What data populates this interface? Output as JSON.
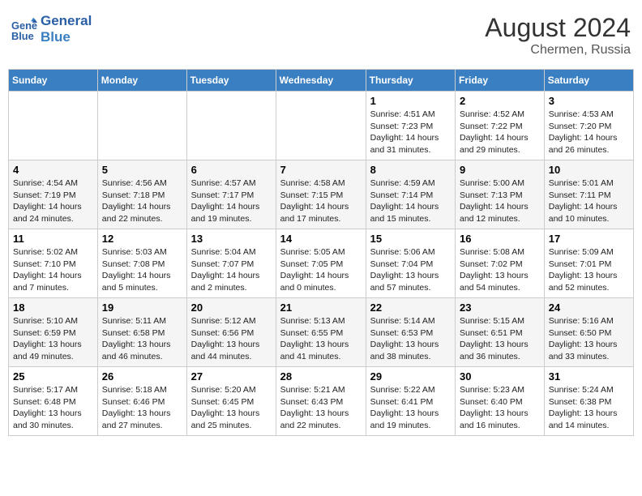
{
  "header": {
    "logo_line1": "General",
    "logo_line2": "Blue",
    "month_year": "August 2024",
    "location": "Chermen, Russia"
  },
  "days_of_week": [
    "Sunday",
    "Monday",
    "Tuesday",
    "Wednesday",
    "Thursday",
    "Friday",
    "Saturday"
  ],
  "weeks": [
    [
      {
        "day": "",
        "detail": ""
      },
      {
        "day": "",
        "detail": ""
      },
      {
        "day": "",
        "detail": ""
      },
      {
        "day": "",
        "detail": ""
      },
      {
        "day": "1",
        "detail": "Sunrise: 4:51 AM\nSunset: 7:23 PM\nDaylight: 14 hours\nand 31 minutes."
      },
      {
        "day": "2",
        "detail": "Sunrise: 4:52 AM\nSunset: 7:22 PM\nDaylight: 14 hours\nand 29 minutes."
      },
      {
        "day": "3",
        "detail": "Sunrise: 4:53 AM\nSunset: 7:20 PM\nDaylight: 14 hours\nand 26 minutes."
      }
    ],
    [
      {
        "day": "4",
        "detail": "Sunrise: 4:54 AM\nSunset: 7:19 PM\nDaylight: 14 hours\nand 24 minutes."
      },
      {
        "day": "5",
        "detail": "Sunrise: 4:56 AM\nSunset: 7:18 PM\nDaylight: 14 hours\nand 22 minutes."
      },
      {
        "day": "6",
        "detail": "Sunrise: 4:57 AM\nSunset: 7:17 PM\nDaylight: 14 hours\nand 19 minutes."
      },
      {
        "day": "7",
        "detail": "Sunrise: 4:58 AM\nSunset: 7:15 PM\nDaylight: 14 hours\nand 17 minutes."
      },
      {
        "day": "8",
        "detail": "Sunrise: 4:59 AM\nSunset: 7:14 PM\nDaylight: 14 hours\nand 15 minutes."
      },
      {
        "day": "9",
        "detail": "Sunrise: 5:00 AM\nSunset: 7:13 PM\nDaylight: 14 hours\nand 12 minutes."
      },
      {
        "day": "10",
        "detail": "Sunrise: 5:01 AM\nSunset: 7:11 PM\nDaylight: 14 hours\nand 10 minutes."
      }
    ],
    [
      {
        "day": "11",
        "detail": "Sunrise: 5:02 AM\nSunset: 7:10 PM\nDaylight: 14 hours\nand 7 minutes."
      },
      {
        "day": "12",
        "detail": "Sunrise: 5:03 AM\nSunset: 7:08 PM\nDaylight: 14 hours\nand 5 minutes."
      },
      {
        "day": "13",
        "detail": "Sunrise: 5:04 AM\nSunset: 7:07 PM\nDaylight: 14 hours\nand 2 minutes."
      },
      {
        "day": "14",
        "detail": "Sunrise: 5:05 AM\nSunset: 7:05 PM\nDaylight: 14 hours\nand 0 minutes."
      },
      {
        "day": "15",
        "detail": "Sunrise: 5:06 AM\nSunset: 7:04 PM\nDaylight: 13 hours\nand 57 minutes."
      },
      {
        "day": "16",
        "detail": "Sunrise: 5:08 AM\nSunset: 7:02 PM\nDaylight: 13 hours\nand 54 minutes."
      },
      {
        "day": "17",
        "detail": "Sunrise: 5:09 AM\nSunset: 7:01 PM\nDaylight: 13 hours\nand 52 minutes."
      }
    ],
    [
      {
        "day": "18",
        "detail": "Sunrise: 5:10 AM\nSunset: 6:59 PM\nDaylight: 13 hours\nand 49 minutes."
      },
      {
        "day": "19",
        "detail": "Sunrise: 5:11 AM\nSunset: 6:58 PM\nDaylight: 13 hours\nand 46 minutes."
      },
      {
        "day": "20",
        "detail": "Sunrise: 5:12 AM\nSunset: 6:56 PM\nDaylight: 13 hours\nand 44 minutes."
      },
      {
        "day": "21",
        "detail": "Sunrise: 5:13 AM\nSunset: 6:55 PM\nDaylight: 13 hours\nand 41 minutes."
      },
      {
        "day": "22",
        "detail": "Sunrise: 5:14 AM\nSunset: 6:53 PM\nDaylight: 13 hours\nand 38 minutes."
      },
      {
        "day": "23",
        "detail": "Sunrise: 5:15 AM\nSunset: 6:51 PM\nDaylight: 13 hours\nand 36 minutes."
      },
      {
        "day": "24",
        "detail": "Sunrise: 5:16 AM\nSunset: 6:50 PM\nDaylight: 13 hours\nand 33 minutes."
      }
    ],
    [
      {
        "day": "25",
        "detail": "Sunrise: 5:17 AM\nSunset: 6:48 PM\nDaylight: 13 hours\nand 30 minutes."
      },
      {
        "day": "26",
        "detail": "Sunrise: 5:18 AM\nSunset: 6:46 PM\nDaylight: 13 hours\nand 27 minutes."
      },
      {
        "day": "27",
        "detail": "Sunrise: 5:20 AM\nSunset: 6:45 PM\nDaylight: 13 hours\nand 25 minutes."
      },
      {
        "day": "28",
        "detail": "Sunrise: 5:21 AM\nSunset: 6:43 PM\nDaylight: 13 hours\nand 22 minutes."
      },
      {
        "day": "29",
        "detail": "Sunrise: 5:22 AM\nSunset: 6:41 PM\nDaylight: 13 hours\nand 19 minutes."
      },
      {
        "day": "30",
        "detail": "Sunrise: 5:23 AM\nSunset: 6:40 PM\nDaylight: 13 hours\nand 16 minutes."
      },
      {
        "day": "31",
        "detail": "Sunrise: 5:24 AM\nSunset: 6:38 PM\nDaylight: 13 hours\nand 14 minutes."
      }
    ]
  ]
}
